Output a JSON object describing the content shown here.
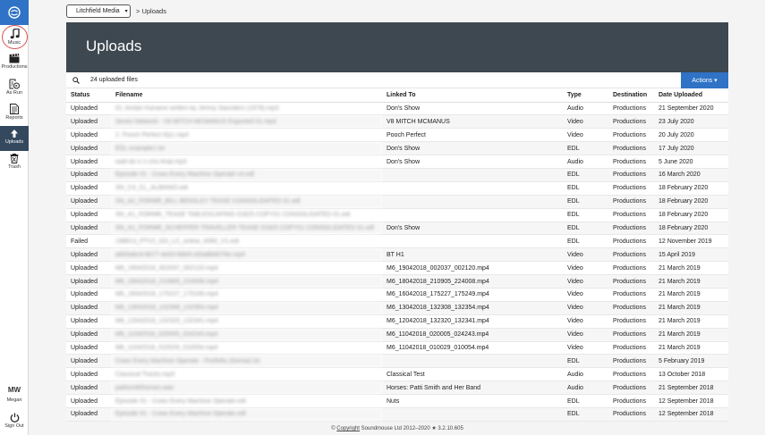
{
  "sidebar": {
    "items": [
      {
        "key": "music",
        "label": "Music",
        "icon": "music-note-icon"
      },
      {
        "key": "productions",
        "label": "Productions",
        "icon": "clapperboard-icon"
      },
      {
        "key": "asrun",
        "label": "As Run",
        "icon": "as-run-icon"
      },
      {
        "key": "reports",
        "label": "Reports",
        "icon": "document-icon"
      },
      {
        "key": "uploads",
        "label": "Uploads",
        "icon": "upload-arrow-icon",
        "active": true
      },
      {
        "key": "trash",
        "label": "Trash",
        "icon": "trash-icon"
      }
    ],
    "user_initials": "MW",
    "user_name": "Megan",
    "signout_label": "Sign Out",
    "accent": "#2f72c6",
    "active_bg": "#34495e",
    "highlight_ring": "#d9534f"
  },
  "topbar": {
    "org_selector": "Litchfield Media",
    "breadcrumb": "> Uploads"
  },
  "page": {
    "title": "Uploads",
    "file_count": "24 uploaded files",
    "actions_label": "Actions ▾"
  },
  "table": {
    "headers": {
      "status": "Status",
      "filename": "Filename",
      "linked": "Linked To",
      "type": "Type",
      "destination": "Destination",
      "date": "Date Uploaded"
    },
    "rows": [
      {
        "status": "Uploaded",
        "filename": "01 Jordan Kanaine written by Jimmy Saunders (1978).mp3",
        "linked": "Don's Show",
        "type": "Audio",
        "destination": "Productions",
        "date": "21 September 2020"
      },
      {
        "status": "Uploaded",
        "filename": "Seven Network - V8 MITCH MCMANUS Exported 01.mp4",
        "linked": "V8 MITCH MCMANUS",
        "type": "Video",
        "destination": "Productions",
        "date": "23 July 2020"
      },
      {
        "status": "Uploaded",
        "filename": "2. Pooch Perfect Ep1.mp4",
        "linked": "Pooch Perfect",
        "type": "Video",
        "destination": "Productions",
        "date": "20 July 2020"
      },
      {
        "status": "Uploaded",
        "filename": "EDL example1.txt",
        "linked": "Don's Show",
        "type": "EDL",
        "destination": "Productions",
        "date": "17 July 2020"
      },
      {
        "status": "Uploaded",
        "filename": "watt-dz-s-1-crtu-final.mp3",
        "linked": "Don's Show",
        "type": "Audio",
        "destination": "Productions",
        "date": "5 June 2020"
      },
      {
        "status": "Uploaded",
        "filename": "Episode 01 - Cows Every Machine Operate v4.edl",
        "linked": "",
        "type": "EDL",
        "destination": "Productions",
        "date": "16 March 2020"
      },
      {
        "status": "Uploaded",
        "filename": "SN_C4_CL_ALBANIO.edl",
        "linked": "",
        "type": "EDL",
        "destination": "Productions",
        "date": "18 February 2020"
      },
      {
        "status": "Uploaded",
        "filename": "SN_A2_FORMR_BILL BENSLEY TEASE CONSOLIDATED 01.edl",
        "linked": "",
        "type": "EDL",
        "destination": "Productions",
        "date": "18 February 2020"
      },
      {
        "status": "Uploaded",
        "filename": "SN_A1_FORMR_TEASE TABLESCAPING 01825 COPY01 CONSOLIDATED 01.edl",
        "linked": "",
        "type": "EDL",
        "destination": "Productions",
        "date": "18 February 2020"
      },
      {
        "status": "Uploaded",
        "filename": "SN_A1_FORMR_SCHEFFER TRAVELLER TEASE 01825 COPY01 CONSOLIDATED 01.edl",
        "linked": "Don's Show",
        "type": "EDL",
        "destination": "Productions",
        "date": "18 February 2020"
      },
      {
        "status": "Failed",
        "filename": "198813_PTV2_GD_LC_online_0060_V1.edl",
        "linked": "",
        "type": "EDL",
        "destination": "Productions",
        "date": "12 November 2019"
      },
      {
        "status": "Uploaded",
        "filename": "a693a6c9-8077-4e63-9de8-c83a8b6078e.mp4",
        "linked": "BT H1",
        "type": "Video",
        "destination": "Productions",
        "date": "15 April 2019"
      },
      {
        "status": "Uploaded",
        "filename": "M6_19042018_002037_002120.mp4",
        "linked": "M6_19042018_002037_002120.mp4",
        "type": "Video",
        "destination": "Productions",
        "date": "21 March 2019"
      },
      {
        "status": "Uploaded",
        "filename": "M6_18042018_210905_224008.mp4",
        "linked": "M6_18042018_210905_224008.mp4",
        "type": "Video",
        "destination": "Productions",
        "date": "21 March 2019"
      },
      {
        "status": "Uploaded",
        "filename": "M6_16042018_175227_175249.mp4",
        "linked": "M6_16042018_175227_175249.mp4",
        "type": "Video",
        "destination": "Productions",
        "date": "21 March 2019"
      },
      {
        "status": "Uploaded",
        "filename": "M6_13042018_132308_132354.mp4",
        "linked": "M6_13042018_132308_132354.mp4",
        "type": "Video",
        "destination": "Productions",
        "date": "21 March 2019"
      },
      {
        "status": "Uploaded",
        "filename": "M6_12042018_132320_132341.mp4",
        "linked": "M6_12042018_132320_132341.mp4",
        "type": "Video",
        "destination": "Productions",
        "date": "21 March 2019"
      },
      {
        "status": "Uploaded",
        "filename": "M6_11042018_020005_024243.mp4",
        "linked": "M6_11042018_020005_024243.mp4",
        "type": "Video",
        "destination": "Productions",
        "date": "21 March 2019"
      },
      {
        "status": "Uploaded",
        "filename": "M6_11042018_010029_010054.mp4",
        "linked": "M6_11042018_010029_010054.mp4",
        "type": "Video",
        "destination": "Productions",
        "date": "21 March 2019"
      },
      {
        "status": "Uploaded",
        "filename": "Cows Every Machine Operate - Portfolio (Gema2.txt",
        "linked": "",
        "type": "EDL",
        "destination": "Productions",
        "date": "5 February 2019"
      },
      {
        "status": "Uploaded",
        "filename": "Classical Tracks.mp3",
        "linked": "Classical Test",
        "type": "Audio",
        "destination": "Productions",
        "date": "13 October 2018"
      },
      {
        "status": "Uploaded",
        "filename": "pattismithhorses.wav",
        "linked": "Horses: Patti Smith and Her Band",
        "type": "Audio",
        "destination": "Productions",
        "date": "21 September 2018"
      },
      {
        "status": "Uploaded",
        "filename": "Episode 01 - Cows Every Machine Operate.edl",
        "linked": "Nuts",
        "type": "EDL",
        "destination": "Productions",
        "date": "12 September 2018"
      },
      {
        "status": "Uploaded",
        "filename": "Episode 01 - Cows Every Machine Operate.edl",
        "linked": "",
        "type": "EDL",
        "destination": "Productions",
        "date": "12 September 2018"
      }
    ]
  },
  "footer": {
    "prefix": "© ",
    "link": "Copyright",
    "suffix": " Soundmouse Ltd 2012–2020 ★ 3.2.10.605"
  },
  "colors": {
    "banner": "#3d4850",
    "actions": "#2f72c6"
  }
}
